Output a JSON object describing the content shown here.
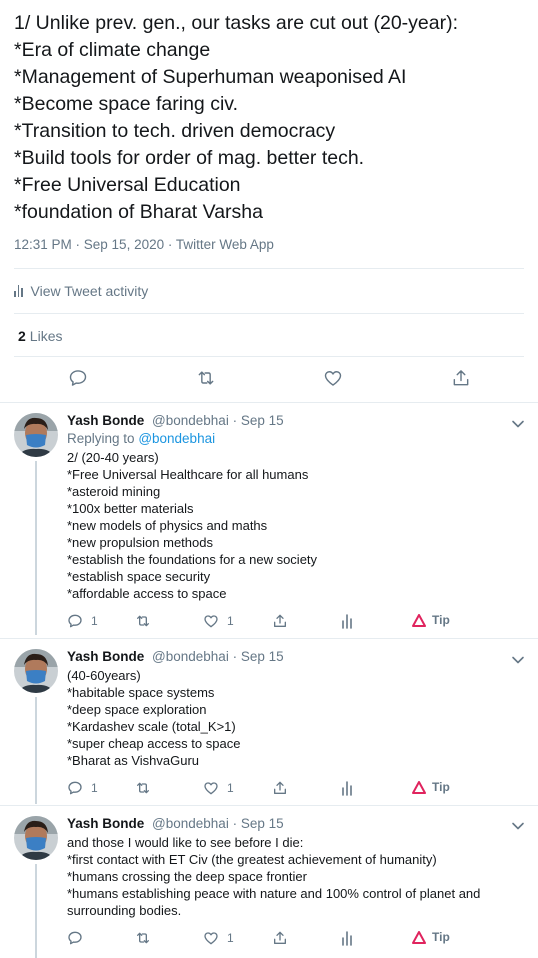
{
  "main_tweet": {
    "lines": [
      "1/ Unlike prev. gen., our tasks are cut out (20-year):",
      "*Era of climate change",
      "*Management of Superhuman weaponised AI",
      "*Become space faring civ.",
      "*Transition to tech. driven democracy",
      "*Build tools for order of mag. better tech.",
      "*Free Universal Education",
      "*foundation of Bharat Varsha"
    ],
    "meta": "12:31 PM · Sep 15, 2020 · Twitter Web App",
    "activity_label": "View Tweet activity",
    "likes_count": "2",
    "likes_label": "Likes"
  },
  "replies": [
    {
      "name": "Yash Bonde",
      "handle": "@bondebhai",
      "date": "· Sep 15",
      "replying_prefix": "Replying to",
      "replying_to": "@bondebhai",
      "lines": [
        "2/ (20-40 years)",
        "*Free Universal Healthcare for all humans",
        "*asteroid mining",
        "*100x better materials",
        "*new models of physics and maths",
        "*new propulsion methods",
        "*establish the foundations for a new society",
        "*establish space security",
        "*affordable access to space"
      ],
      "reply_count": "1",
      "like_count": "1",
      "tip_label": "Tip"
    },
    {
      "name": "Yash Bonde",
      "handle": "@bondebhai",
      "date": "· Sep 15",
      "lines": [
        "(40-60years)",
        "*habitable space systems",
        "*deep space exploration",
        "*Kardashev scale (total_K>1)",
        "*super cheap access to space",
        "*Bharat as VishvaGuru"
      ],
      "reply_count": "1",
      "like_count": "1",
      "tip_label": "Tip"
    },
    {
      "name": "Yash Bonde",
      "handle": "@bondebhai",
      "date": "· Sep 15",
      "lines": [
        "and those I would like to see before I die:",
        "*first contact with ET Civ (the greatest achievement of humanity)",
        "*humans crossing the deep space frontier",
        "*humans establishing peace with nature and 100% control of planet and",
        "surrounding bodies."
      ],
      "like_count": "1",
      "tip_label": "Tip"
    }
  ],
  "colors": {
    "text": "#14171a",
    "secondary": "#657786",
    "link": "#1b95e0",
    "divider": "#e6ecf0",
    "tip_red": "#e0245e"
  }
}
